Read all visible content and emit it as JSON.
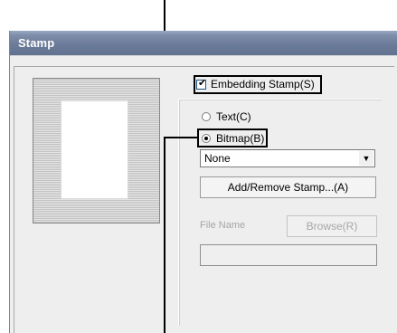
{
  "window": {
    "title": "Stamp"
  },
  "stamp": {
    "embedding_label": "Embedding Stamp(S)",
    "embedding_checked": true,
    "text_option": "Text(C)",
    "bitmap_option": "Bitmap(B)",
    "selected_option": "bitmap",
    "dropdown_value": "None",
    "add_remove_button": "Add/Remove Stamp...(A)",
    "file_name_label": "File Name",
    "browse_button": "Browse(R)",
    "file_name_value": ""
  },
  "icons": {
    "check": "check-mark-icon",
    "dropdown": "chevron-down-icon"
  }
}
